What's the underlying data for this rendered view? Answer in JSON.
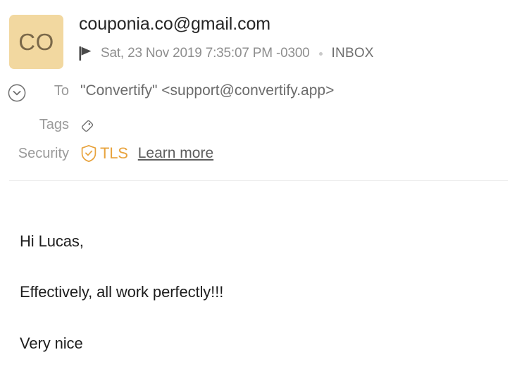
{
  "header": {
    "avatar": {
      "initials": "CO",
      "background_color": "#f2d8a0",
      "text_color": "#7a6849"
    },
    "sender": "couponia.co@gmail.com",
    "flag_icon": "flag-icon",
    "date": "Sat, 23 Nov 2019 7:35:07 PM -0300",
    "folder": "INBOX",
    "expand_icon": "chevron-down-circle-icon",
    "rows": {
      "to": {
        "label": "To",
        "value": "\"Convertify\" <support@convertify.app>"
      },
      "tags": {
        "label": "Tags",
        "icon": "tag-icon"
      },
      "security": {
        "label": "Security",
        "icon": "shield-check-icon",
        "protocol": "TLS",
        "link": "Learn more",
        "accent_color": "#e8a33d"
      }
    }
  },
  "body": {
    "paragraphs": [
      "Hi Lucas,",
      "Effectively, all work perfectly!!!",
      "Very nice"
    ]
  }
}
